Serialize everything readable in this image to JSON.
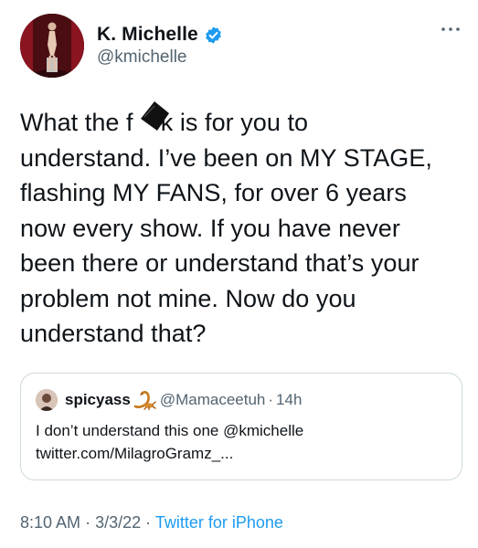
{
  "author": {
    "display_name": "K. Michelle",
    "handle": "@kmichelle",
    "verified": true
  },
  "tweet": {
    "lines": [
      "What the f    k is for you to",
      "understand. I’ve been on MY STAGE,",
      "flashing MY FANS, for over 6 years",
      "now every show. If you have never",
      "been there or understand that’s your",
      "problem not mine. Now do you",
      "understand that?"
    ]
  },
  "quote": {
    "display_name": "spicyass",
    "handle": "@Mamaceetuh",
    "separator": "·",
    "time": "14h",
    "lines": [
      "I don’t understand this one @kmichelle",
      "twitter.com/MilagroGramz_..."
    ]
  },
  "footer": {
    "time": "8:10 AM",
    "sep1": "·",
    "date": "3/3/22",
    "sep2": "·",
    "source": "Twitter for iPhone"
  },
  "colors": {
    "text": "#0f1419",
    "secondary": "#536471",
    "accent": "#1d9bf0",
    "border": "#cfd9de"
  },
  "icons": [
    "verified-badge-icon",
    "more-options-icon",
    "censor-blot-icon",
    "scorpion-emoji-icon"
  ]
}
